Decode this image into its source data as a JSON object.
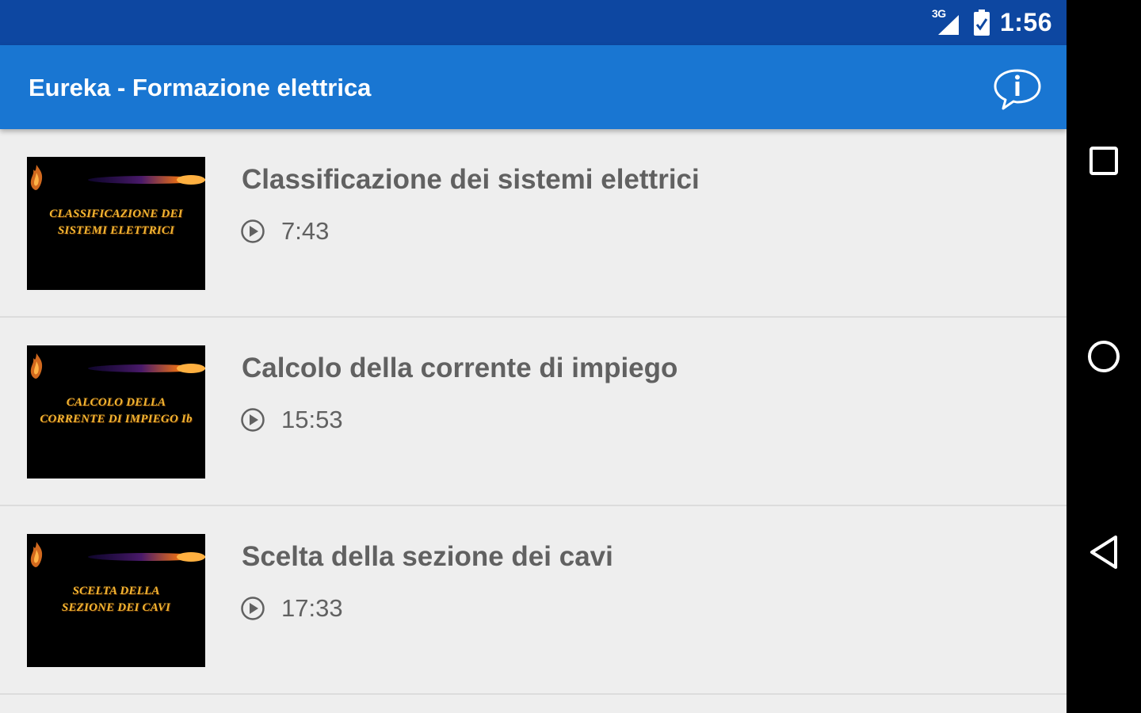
{
  "status_bar": {
    "network_label": "3G",
    "time": "1:56"
  },
  "app_bar": {
    "title": "Eureka - Formazione elettrica",
    "info_icon": "info-bubble-icon"
  },
  "videos": [
    {
      "title": "Classificazione dei sistemi elettrici",
      "duration": "7:43",
      "thumbnail_text": "CLASSIFICAZIONE DEI\nSISTEMI ELETTRICI"
    },
    {
      "title": "Calcolo della corrente di impiego",
      "duration": "15:53",
      "thumbnail_text": "CALCOLO DELLA\nCORRENTE DI IMPIEGO Ib"
    },
    {
      "title": "Scelta della sezione dei cavi",
      "duration": "17:33",
      "thumbnail_text": "SCELTA DELLA\nSEZIONE DEI CAVI"
    }
  ],
  "navigation_bar": {
    "buttons": [
      "recents-icon",
      "home-icon",
      "back-icon"
    ]
  },
  "colors": {
    "status_bar": "#0d47a1",
    "app_bar": "#1976d2",
    "list_background": "#eeeeee",
    "text_primary": "#616161",
    "thumbnail_text": "#f2b632"
  }
}
